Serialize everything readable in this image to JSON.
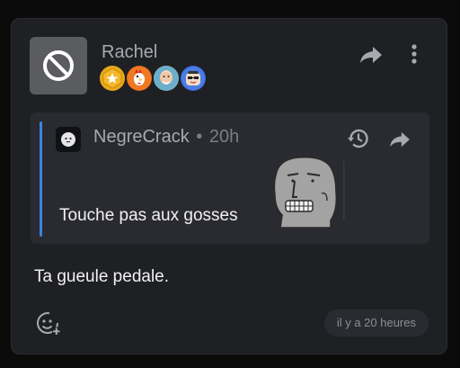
{
  "post": {
    "author": "Rachel",
    "avatar_icon": "ban-icon",
    "badges": [
      "star-badge",
      "rooster-badge",
      "old-man-badge",
      "npc-badge"
    ],
    "message": "Ta gueule pedale.",
    "timestamp": "il y a 20 heures",
    "react_icon": "add-reaction-icon"
  },
  "quote": {
    "author": "NegreCrack",
    "separator": "•",
    "time": "20h",
    "text": "Touche pas aux gosses",
    "accent_color": "#3b82e0",
    "sticker_icon": "npc-sticker"
  },
  "actions": {
    "share_icon": "share-icon",
    "more_icon": "more-vertical-icon",
    "history_icon": "history-icon"
  }
}
